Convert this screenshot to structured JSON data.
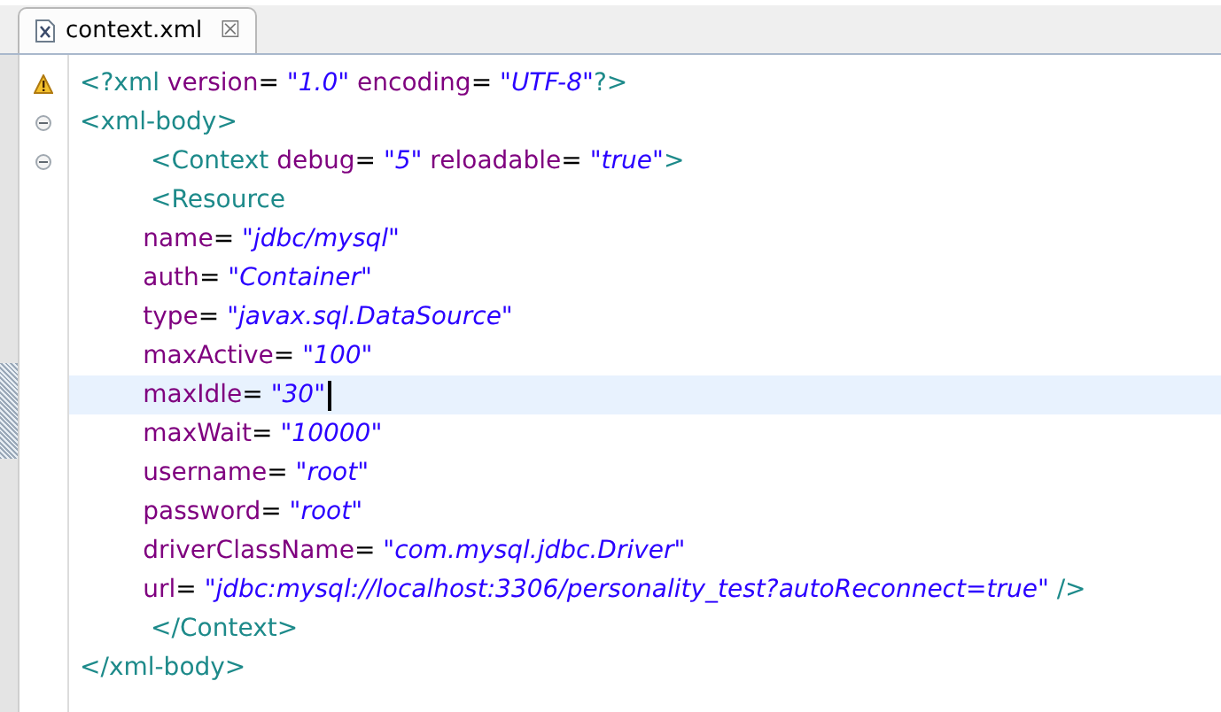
{
  "tabs": [
    {
      "label": "context.xml",
      "selected": true,
      "close": "☒"
    }
  ],
  "lines": [
    {
      "kind": "warning",
      "current": false,
      "tokens": [
        {
          "kind": "tag",
          "text": "<?xml"
        },
        {
          "kind": "attr",
          "text": " version"
        },
        {
          "kind": "eq",
          "text": "= "
        },
        {
          "kind": "value",
          "text": "\"1.0\""
        },
        {
          "kind": "attr",
          "text": " encoding"
        },
        {
          "kind": "eq",
          "text": "= "
        },
        {
          "kind": "value",
          "text": "\"UTF-8\""
        },
        {
          "kind": "tag",
          "text": "?>"
        }
      ]
    },
    {
      "kind": "fold",
      "current": false,
      "tokens": [
        {
          "kind": "tag",
          "text": "<xml-body>"
        }
      ]
    },
    {
      "kind": "fold",
      "current": false,
      "tokens": [
        {
          "kind": "tag",
          "text": "\t\t <Context"
        },
        {
          "kind": "attr",
          "text": " debug"
        },
        {
          "kind": "eq",
          "text": "= "
        },
        {
          "kind": "value",
          "text": "\"5\""
        },
        {
          "kind": "attr",
          "text": " reloadable"
        },
        {
          "kind": "eq",
          "text": "= "
        },
        {
          "kind": "value",
          "text": "\"true\""
        },
        {
          "kind": "tag",
          "text": ">"
        }
      ]
    },
    {
      "current": false,
      "tokens": [
        {
          "kind": "tag",
          "text": "\t\t <Resource"
        }
      ]
    },
    {
      "current": false,
      "tokens": [
        {
          "kind": "attr",
          "text": "\t\tname"
        },
        {
          "kind": "eq",
          "text": "= "
        },
        {
          "kind": "value",
          "text": "\"jdbc/mysql\""
        }
      ]
    },
    {
      "current": false,
      "tokens": [
        {
          "kind": "attr",
          "text": "\t\tauth"
        },
        {
          "kind": "eq",
          "text": "= "
        },
        {
          "kind": "value",
          "text": "\"Container\""
        }
      ]
    },
    {
      "current": false,
      "tokens": [
        {
          "kind": "attr",
          "text": "\t\ttype"
        },
        {
          "kind": "eq",
          "text": "= "
        },
        {
          "kind": "value",
          "text": "\"javax.sql.DataSource\""
        }
      ]
    },
    {
      "current": false,
      "tokens": [
        {
          "kind": "attr",
          "text": "\t\tmaxActive"
        },
        {
          "kind": "eq",
          "text": "= "
        },
        {
          "kind": "value",
          "text": "\"100\""
        }
      ]
    },
    {
      "current": true,
      "tokens": [
        {
          "kind": "attr",
          "text": "\t\tmaxIdle"
        },
        {
          "kind": "eq",
          "text": "= "
        },
        {
          "kind": "value",
          "text": "\"30\""
        }
      ]
    },
    {
      "current": false,
      "tokens": [
        {
          "kind": "attr",
          "text": "\t\tmaxWait"
        },
        {
          "kind": "eq",
          "text": "= "
        },
        {
          "kind": "value",
          "text": "\"10000\""
        }
      ]
    },
    {
      "current": false,
      "tokens": [
        {
          "kind": "attr",
          "text": "\t\tusername"
        },
        {
          "kind": "eq",
          "text": "= "
        },
        {
          "kind": "value",
          "text": "\"root\""
        }
      ]
    },
    {
      "current": false,
      "tokens": [
        {
          "kind": "attr",
          "text": "\t\tpassword"
        },
        {
          "kind": "eq",
          "text": "= "
        },
        {
          "kind": "value",
          "text": "\"root\""
        }
      ]
    },
    {
      "current": false,
      "tokens": [
        {
          "kind": "attr",
          "text": "\t\tdriverClassName"
        },
        {
          "kind": "eq",
          "text": "= "
        },
        {
          "kind": "value",
          "text": "\"com.mysql.jdbc.Driver\""
        }
      ]
    },
    {
      "current": false,
      "tokens": [
        {
          "kind": "attr",
          "text": "\t\turl"
        },
        {
          "kind": "eq",
          "text": "= "
        },
        {
          "kind": "value",
          "text": "\"jdbc:mysql://localhost:3306/personality_test?autoReconnect=true\""
        },
        {
          "kind": "tag",
          "text": " />"
        }
      ]
    },
    {
      "current": false,
      "tokens": [
        {
          "kind": "tag",
          "text": "\t\t </Context>"
        }
      ]
    },
    {
      "current": false,
      "tokens": [
        {
          "kind": "tag",
          "text": "</xml-body>"
        }
      ]
    }
  ]
}
